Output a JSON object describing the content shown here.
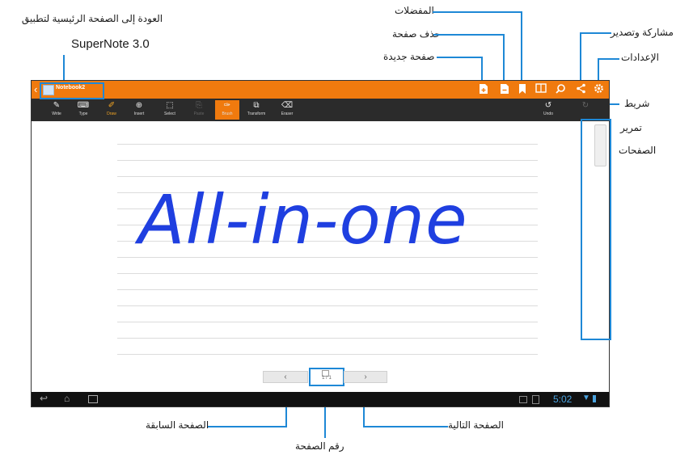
{
  "callouts": {
    "home": {
      "line1": "العودة إلى الصفحة الرئيسية لتطبيق",
      "line2": "SuperNote 3.0"
    },
    "favorites": "المفضلات",
    "delete_page": "حذف صفحة",
    "new_page": "صفحة جديدة",
    "share_export": "مشاركة وتصدير",
    "settings": "الإعدادات",
    "scroll_bar": {
      "line1": "شريط",
      "line2": "تمرير",
      "line3": "الصفحات"
    },
    "previous_page": "الصفحة السابقة",
    "next_page": "الصفحة التالية",
    "page_number": "رقم الصفحة"
  },
  "app": {
    "notebook_title": "Notebook2",
    "tools": [
      "Write",
      "Type",
      "Draw",
      "Insert",
      "Select",
      "Paste",
      "Brush",
      "Transform",
      "Eraser"
    ],
    "undo_label": "Undo",
    "handwriting": "All-in-one",
    "page_indicator": "1 / 1",
    "clock": "5:02"
  },
  "icons": {
    "back": "chevron-left-icon",
    "new_page": "new-page-icon",
    "delete_page": "delete-page-icon",
    "favorite": "bookmark-icon",
    "view": "page-view-icon",
    "search": "search-icon",
    "share": "share-icon",
    "settings": "gear-icon"
  },
  "colors": {
    "accent": "#f07a0e",
    "callout_line": "#1e88d6",
    "ink": "#1f3fe0",
    "toolbar": "#2b2b2b"
  }
}
